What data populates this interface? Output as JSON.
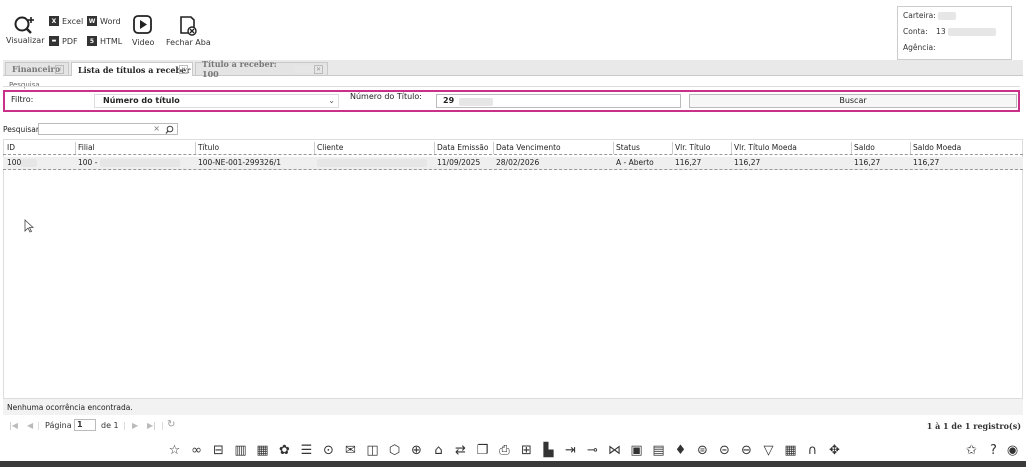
{
  "toolbar": {
    "visualizar": "Visualizar",
    "excel": "Excel",
    "word": "Word",
    "pdf": "PDF",
    "html": "HTML",
    "video": "Video",
    "fechar_aba": "Fechar Aba"
  },
  "account": {
    "carteira_label": "Carteira:",
    "conta_label": "Conta:",
    "conta_value": "13",
    "agencia_label": "Agência:"
  },
  "tabs": [
    {
      "label": "Financeiro"
    },
    {
      "label": "Lista de títulos a receber"
    },
    {
      "label": "Título a receber: 100"
    }
  ],
  "filter": {
    "section_label": "Pesquisa",
    "filtro_label": "Filtro:",
    "filtro_value": "Número do título",
    "numero_label": "Número do Título:",
    "numero_value": "29",
    "buscar_label": "Buscar"
  },
  "search": {
    "label": "Pesquisar"
  },
  "table": {
    "columns": [
      "ID",
      "Filial",
      "Título",
      "Cliente",
      "Data Emissão",
      "Data Vencimento",
      "Status",
      "Vlr. Título",
      "Vlr. Título Moeda",
      "Saldo",
      "Saldo Moeda"
    ],
    "rows": [
      {
        "id": "100",
        "filial": "100 -",
        "titulo": "100-NE-001-299326/1",
        "cliente": "",
        "data_emissao": "11/09/2025",
        "data_vencimento": "28/02/2026",
        "status": "A - Aberto",
        "vlr_titulo": "116,27",
        "vlr_titulo_moeda": "116,27",
        "saldo": "116,27",
        "saldo_moeda": "116,27"
      }
    ]
  },
  "status_message": "Nenhuma ocorrência encontrada.",
  "pager": {
    "pagina_label": "Página",
    "page_value": "1",
    "de_label": "de 1",
    "records": "1 à 1 de 1 registro(s)"
  }
}
